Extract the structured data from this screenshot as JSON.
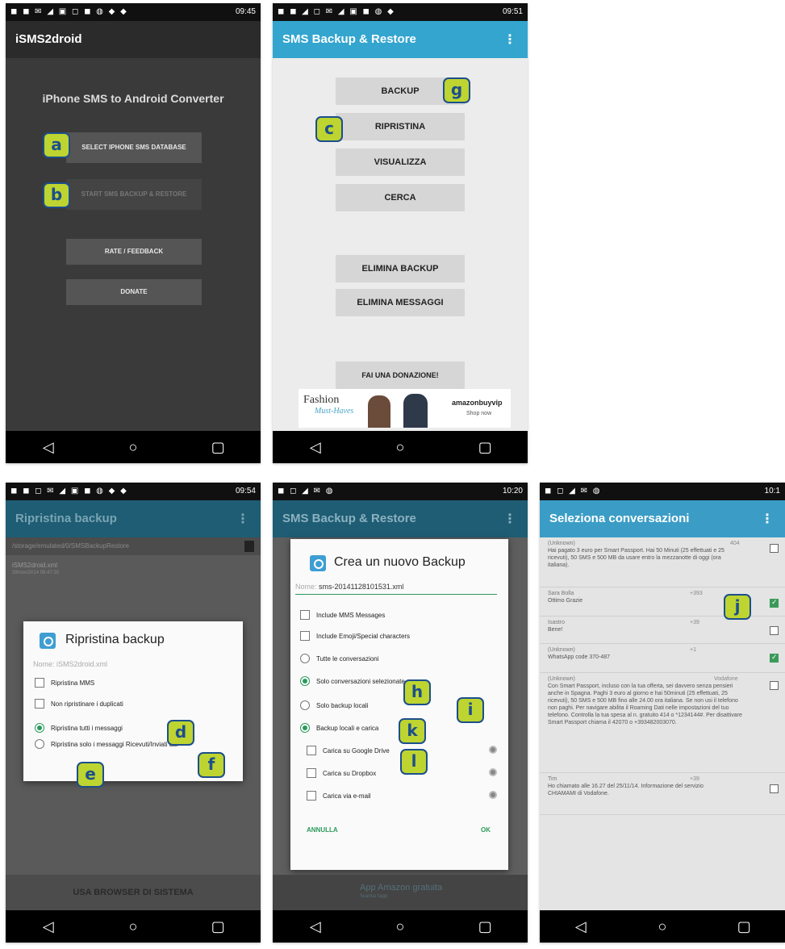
{
  "phone1": {
    "status_time": "09:45",
    "app_title": "iSMS2droid",
    "heading": "iPhone SMS to Android Converter",
    "buttons": {
      "select": "SELECT IPHONE SMS DATABASE",
      "start": "START SMS BACKUP & RESTORE",
      "rate": "RATE / FEEDBACK",
      "donate": "DONATE"
    },
    "badges": {
      "a": "a",
      "b": "b"
    }
  },
  "phone2": {
    "status_time": "09:51",
    "app_title": "SMS Backup & Restore",
    "buttons": {
      "backup": "BACKUP",
      "restore": "RIPRISTINA",
      "view": "VISUALIZZA",
      "search": "CERCA",
      "delete_backup": "ELIMINA BACKUP",
      "delete_messages": "ELIMINA MESSAGGI",
      "donate": "FAI UNA DONAZIONE!"
    },
    "ad": {
      "left_title": "Fashion",
      "left_sub": "Must-Haves",
      "brand": "amazonbuyvip",
      "brand_sub": "Shop now"
    },
    "badges": {
      "c": "c",
      "g": "g"
    }
  },
  "phone3": {
    "status_time": "09:54",
    "app_title": "Ripristina backup",
    "subbar": "/storage/emulated/0/SMSBackupRestore",
    "file_name": "iSMS2droid.xml",
    "file_date": "28/nov/2014 09:47:30",
    "dialog": {
      "title": "Ripristina backup",
      "name_label": "Nome:",
      "name_value": "iSMS2droid.xml",
      "options": [
        "Ripristina MMS",
        "Non ripristinare i duplicati",
        "Ripristina tutti i messaggi",
        "Ripristina solo i messaggi Ricevuti/Inviati dal"
      ],
      "ok": "OK"
    },
    "bottom_button": "USA BROWSER DI SISTEMA",
    "badges": {
      "d": "d",
      "e": "e",
      "f": "f"
    }
  },
  "phone4": {
    "status_time": "10:20",
    "app_title": "SMS Backup & Restore",
    "dialog": {
      "title": "Crea un nuovo Backup",
      "name_label": "Nome:",
      "name_value": "sms-20141128101531.xml",
      "options": [
        "Include MMS Messages",
        "Include Emoji/Special characters",
        "Tutte le conversazioni",
        "Solo conversazioni selezionate",
        "Solo backup locali",
        "Backup locali e carica",
        "Carica su Google Drive",
        "Carica su Dropbox",
        "Carica via e-mail"
      ],
      "cancel": "ANNULLA",
      "ok": "OK"
    },
    "ad_text": "App Amazon gratuita",
    "ad_sub": "Scarica l'app",
    "badges": {
      "h": "h",
      "i": "i",
      "k": "k",
      "l": "l"
    }
  },
  "phone5": {
    "status_time": "10:1",
    "app_title": "Seleziona conversazioni",
    "conversations": [
      {
        "name": "(Unknown)",
        "num": "404",
        "text": "Hai pagato 3 euro per Smart Passport. Hai 50 Minuti (25 effettuati e 25 ricevuti), 50 SMS e 500 MB da usare entro la mezzanotte di oggi (ora italiana).",
        "checked": false
      },
      {
        "name": "Sara Bolla",
        "num": "+393",
        "text": "Ottimo Grazie",
        "checked": true
      },
      {
        "name": "Isastro",
        "num": "+39",
        "text": "Bene!",
        "checked": false
      },
      {
        "name": "(Unknown)",
        "num": "+1",
        "text": "WhatsApp code 370-487",
        "checked": true
      },
      {
        "name": "(Unknown)",
        "num": "Vodafone",
        "text": "Con Smart Passport, incluso con la tua offerta, sei davvero senza pensieri anche in Spagna. Paghi 3 euro al giorno e hai 50minuti (25 effettuati, 25 ricevuti), 50 SMS e 500 MB fino alle 24.00 ora italiana. Se non usi il telefono non paghi. Per navigare abilita il Roaming Dati nelle impostazioni del tuo telefono. Controlla la tua spesa al n. gratuito 414 o *1234144#. Per disattivare Smart Passport chiama il 42070 o +393482003070.",
        "checked": false
      },
      {
        "name": "Tim",
        "num": "+39",
        "text": "Ho chiamato alle 16.27 del 25/11/14. Informazione del servizio CHIAMAMI di Vodafone.",
        "checked": false
      }
    ],
    "badges": {
      "j": "j"
    }
  },
  "colors": {
    "badge_fill": "#bed430",
    "badge_border": "#1c4f8c",
    "accent_blue": "#33a5cf",
    "accent_green": "#2a9a5c"
  },
  "icons": {
    "back": "back-triangle-icon",
    "home": "home-circle-icon",
    "recents": "recents-square-icon",
    "overflow": "overflow-menu-icon"
  }
}
